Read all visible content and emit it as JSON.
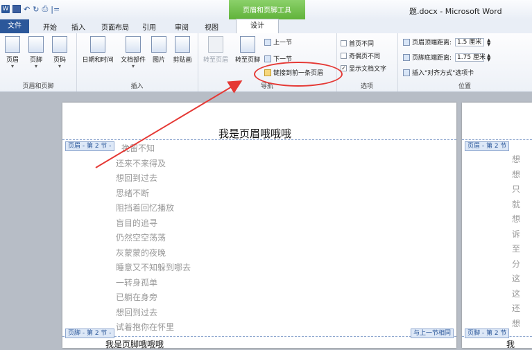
{
  "window": {
    "title": "题.docx - Microsoft Word",
    "context_tab_group": "页眉和页脚工具"
  },
  "quick_access": {
    "separator": "|="
  },
  "tabs": {
    "file": "文件",
    "home": "开始",
    "insert": "插入",
    "layout": "页面布局",
    "references": "引用",
    "review": "审阅",
    "view": "视图",
    "design": "设计"
  },
  "ribbon": {
    "group_header_footer": {
      "label": "页眉和页脚",
      "header": "页眉",
      "footer": "页脚",
      "page_number": "页码"
    },
    "group_insert": {
      "label": "插入",
      "date_time": "日期和时间",
      "doc_parts": "文档部件",
      "picture": "图片",
      "clip_art": "剪贴画"
    },
    "group_navigation": {
      "label": "导航",
      "goto_header": "转至页眉",
      "goto_footer": "转至页脚",
      "previous": "上一节",
      "next": "下一节",
      "link_previous": "链接到前一条页眉"
    },
    "group_options": {
      "label": "选项",
      "different_first": "首页不同",
      "different_odd_even": "奇偶页不同",
      "show_doc_text": "显示文档文字",
      "show_doc_text_checked": true,
      "checkmark": "✓"
    },
    "group_position": {
      "label": "位置",
      "header_top": "页眉顶端距离:",
      "header_top_value": "1.5 厘米",
      "footer_bottom": "页脚底端距离:",
      "footer_bottom_value": "1.75 厘米",
      "insert_align_tab": "插入\"对齐方式\"选项卡"
    }
  },
  "document": {
    "header_text": "我是页眉哦哦哦",
    "header_badge": "页眉 - 第 2 节 -",
    "footer_badge": "页脚 - 第 2 节 -",
    "same_as_previous": "与上一节相同",
    "footer_text": "我是页脚哦哦哦",
    "body_lines": [
      "挽留不知",
      "还来不来得及",
      "想回到过去",
      "思绪不断",
      "阻挡着回忆播放",
      "盲目的追寻",
      "仍然空空荡荡",
      "灰蒙蒙的夜晚",
      "睡意又不知躲到哪去",
      "一转身孤单",
      "已躺在身旁",
      "想回到过去",
      "试着抱你在怀里"
    ]
  },
  "page2": {
    "header_badge": "页眉 - 第 2 节",
    "footer_badge": "页脚 - 第 2 节",
    "chars": [
      "想",
      "想",
      "只",
      "就",
      "想",
      "诉",
      "至",
      "分",
      "这",
      "这",
      "还",
      "想"
    ],
    "footer_char": "我"
  },
  "annotations": {
    "arrow_color": "#e53935"
  }
}
